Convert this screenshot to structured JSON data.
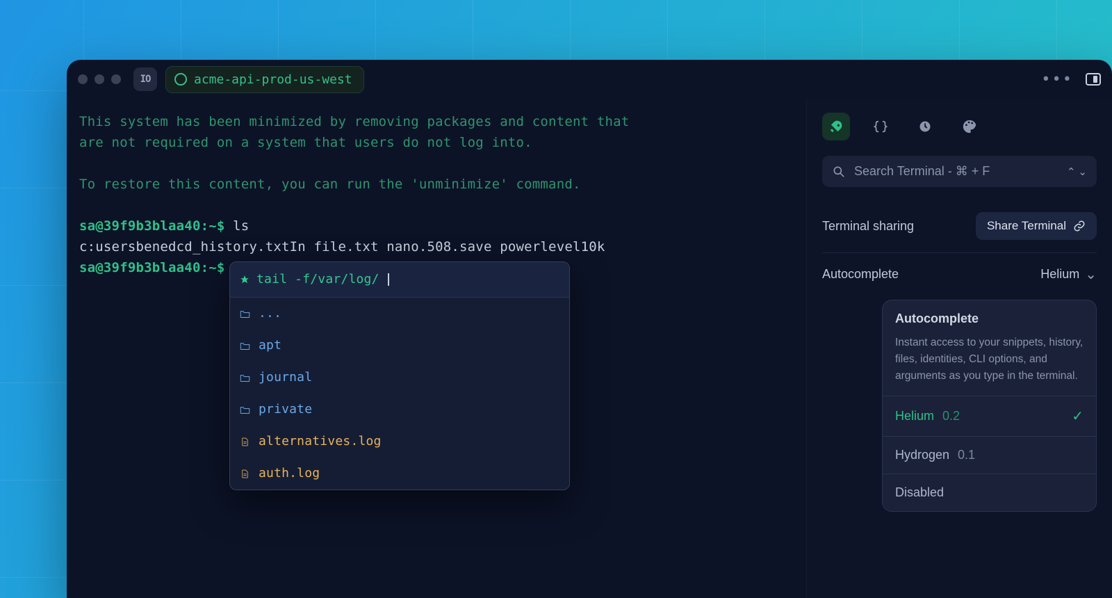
{
  "titlebar": {
    "app_badge": "IO",
    "host": "acme-api-prod-us-west"
  },
  "terminal": {
    "motd_line1": "This system has been minimized by removing packages and content that",
    "motd_line2": "are not required on a system that users do not log into.",
    "motd_line3": "To restore this content, you can run the 'unminimize' command.",
    "prompt": "sa@39f9b3blaa40:~$ ",
    "cmd_ls": "ls",
    "ls_output": "c:usersbenedcd_history.txtIn file.txt nano.508.save powerlevel10k",
    "cmd_tail": "tail -f"
  },
  "popup": {
    "head": "tail -f/var/log/",
    "items": [
      {
        "type": "folder",
        "label": "..."
      },
      {
        "type": "folder",
        "label": "apt"
      },
      {
        "type": "folder",
        "label": "journal"
      },
      {
        "type": "folder",
        "label": "private"
      },
      {
        "type": "file",
        "label": "alternatives.log"
      },
      {
        "type": "file",
        "label": "auth.log"
      }
    ]
  },
  "side": {
    "search_placeholder": "Search Terminal - ⌘ + F",
    "sharing_label": "Terminal sharing",
    "share_button": "Share Terminal",
    "autocomplete_label": "Autocomplete",
    "autocomplete_selected": "Helium",
    "card": {
      "title": "Autocomplete",
      "desc": "Instant access to your snippets, history, files, identities, CLI options, and arguments as you type in the terminal.",
      "options": [
        {
          "name": "Helium",
          "version": "0.2",
          "active": true
        },
        {
          "name": "Hydrogen",
          "version": "0.1",
          "active": false
        },
        {
          "name": "Disabled",
          "version": "",
          "active": false
        }
      ]
    }
  }
}
